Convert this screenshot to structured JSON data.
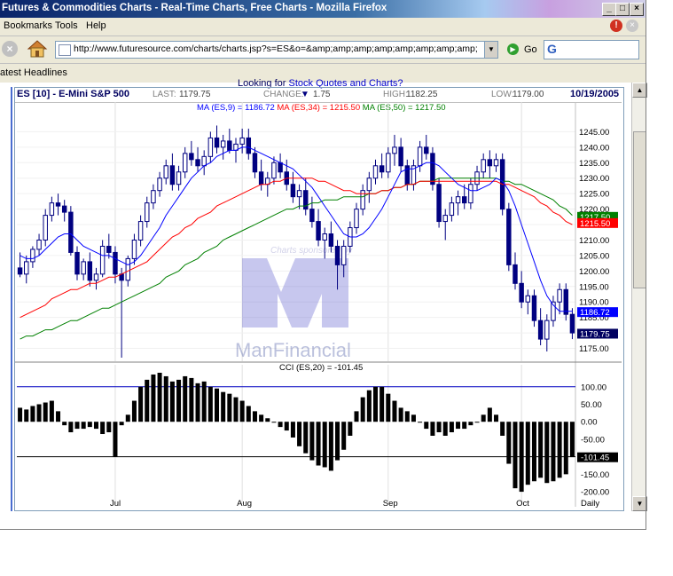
{
  "window": {
    "title": "Futures & Commodities Charts - Real-Time Charts, Free Charts - Mozilla Firefox",
    "min": "_",
    "max": "□",
    "close": "×"
  },
  "menu": {
    "items": [
      "Bookmarks",
      "Tools",
      "Help"
    ]
  },
  "nav": {
    "url": "http://www.futuresource.com/charts/charts.jsp?s=ES&o=&amp;amp;amp;amp;amp;amp;amp;amp;amp;a=D&z=",
    "go_label": "Go",
    "search_value": "G"
  },
  "bookmarks": {
    "headlines": "atest Headlines"
  },
  "page": {
    "prompt_prefix": "Looking for",
    "prompt_link": "Stock Quotes and Charts?"
  },
  "chart_header": {
    "symbol": "ES [10] - E-Mini S&P 500",
    "last_label": "LAST:",
    "last_value": "1179.75",
    "change_label": "CHANGE:",
    "change_arrow": "▼",
    "change_value": "1.75",
    "high_label": "HIGH:",
    "high_value": "1182.25",
    "low_label": "LOW:",
    "low_value": "1179.00",
    "date": "10/19/2005"
  },
  "ma_legend": {
    "ma9": "MA (ES,9) = 1186.72",
    "ma34": "MA (ES,34) = 1215.50",
    "ma50": "MA (ES,50) = 1217.50"
  },
  "watermark": {
    "sponsor": "Charts sponsored by",
    "brand": "ManFinancial"
  },
  "cci_label": "CCI (ES,20) = -101.45",
  "colors": {
    "ma9": "#0000ff",
    "ma34": "#ff0000",
    "ma50": "#008000",
    "header": "#000060"
  },
  "chart_data": {
    "type": "candlestick",
    "price_axis": {
      "ticks": [
        1175,
        1180,
        1185,
        1190,
        1195,
        1200,
        1205,
        1210,
        1215,
        1220,
        1225,
        1230,
        1235,
        1240,
        1245
      ],
      "ylim": [
        1172,
        1250
      ]
    },
    "tick_labels": [
      "1175.00",
      "1180.00",
      "1185.00",
      "1190.00",
      "1195.00",
      "1200.00",
      "1205.00",
      "1210.00",
      "1215.00",
      "1220.00",
      "1225.00",
      "1230.00",
      "1235.00",
      "1240.00",
      "1245.00"
    ],
    "price_tags": [
      {
        "label": "1217.50",
        "value": 1217.5,
        "color": "#008000"
      },
      {
        "label": "1215.50",
        "value": 1215.5,
        "color": "#ff0000"
      },
      {
        "label": "1186.72",
        "value": 1186.72,
        "color": "#0000ff"
      },
      {
        "label": "1179.75",
        "value": 1179.75,
        "color": "#000060"
      }
    ],
    "x_labels": [
      {
        "label": "Jul",
        "index": 15
      },
      {
        "label": "Aug",
        "index": 35
      },
      {
        "label": "Sep",
        "index": 58
      },
      {
        "label": "Oct",
        "index": 79
      },
      {
        "label": "Daily",
        "index": 92
      }
    ],
    "candles": [
      [
        1201,
        1206,
        1198,
        1199
      ],
      [
        1199,
        1205,
        1196,
        1203
      ],
      [
        1203,
        1208,
        1201,
        1207
      ],
      [
        1207,
        1212,
        1205,
        1210
      ],
      [
        1210,
        1220,
        1208,
        1218
      ],
      [
        1218,
        1224,
        1216,
        1222
      ],
      [
        1222,
        1225,
        1218,
        1221
      ],
      [
        1221,
        1223,
        1216,
        1219
      ],
      [
        1219,
        1221,
        1205,
        1206
      ],
      [
        1206,
        1208,
        1197,
        1199
      ],
      [
        1199,
        1204,
        1197,
        1203
      ],
      [
        1203,
        1206,
        1195,
        1197
      ],
      [
        1197,
        1201,
        1194,
        1199
      ],
      [
        1199,
        1210,
        1198,
        1208
      ],
      [
        1208,
        1212,
        1204,
        1206
      ],
      [
        1206,
        1208,
        1196,
        1199
      ],
      [
        1199,
        1201,
        1172,
        1197
      ],
      [
        1197,
        1205,
        1195,
        1204
      ],
      [
        1204,
        1212,
        1202,
        1210
      ],
      [
        1210,
        1218,
        1208,
        1216
      ],
      [
        1216,
        1224,
        1214,
        1222
      ],
      [
        1222,
        1228,
        1220,
        1226
      ],
      [
        1226,
        1232,
        1224,
        1230
      ],
      [
        1230,
        1236,
        1228,
        1234
      ],
      [
        1234,
        1238,
        1226,
        1228
      ],
      [
        1228,
        1234,
        1226,
        1232
      ],
      [
        1232,
        1240,
        1230,
        1238
      ],
      [
        1238,
        1242,
        1234,
        1236
      ],
      [
        1236,
        1240,
        1232,
        1234
      ],
      [
        1234,
        1239,
        1231,
        1237
      ],
      [
        1237,
        1245,
        1235,
        1243
      ],
      [
        1243,
        1247,
        1238,
        1240
      ],
      [
        1240,
        1244,
        1236,
        1242
      ],
      [
        1242,
        1246,
        1238,
        1239
      ],
      [
        1239,
        1243,
        1235,
        1241
      ],
      [
        1241,
        1246,
        1238,
        1243
      ],
      [
        1243,
        1246,
        1236,
        1238
      ],
      [
        1238,
        1240,
        1230,
        1232
      ],
      [
        1232,
        1236,
        1226,
        1228
      ],
      [
        1228,
        1232,
        1224,
        1230
      ],
      [
        1230,
        1237,
        1228,
        1235
      ],
      [
        1235,
        1238,
        1230,
        1232
      ],
      [
        1232,
        1236,
        1226,
        1228
      ],
      [
        1228,
        1232,
        1222,
        1224
      ],
      [
        1224,
        1228,
        1220,
        1226
      ],
      [
        1226,
        1230,
        1218,
        1220
      ],
      [
        1220,
        1224,
        1214,
        1216
      ],
      [
        1216,
        1220,
        1208,
        1210
      ],
      [
        1210,
        1214,
        1204,
        1212
      ],
      [
        1212,
        1216,
        1206,
        1208
      ],
      [
        1208,
        1210,
        1194,
        1202
      ],
      [
        1202,
        1210,
        1198,
        1208
      ],
      [
        1208,
        1216,
        1206,
        1214
      ],
      [
        1214,
        1222,
        1212,
        1220
      ],
      [
        1220,
        1228,
        1218,
        1226
      ],
      [
        1226,
        1232,
        1222,
        1230
      ],
      [
        1230,
        1236,
        1228,
        1234
      ],
      [
        1234,
        1238,
        1230,
        1232
      ],
      [
        1232,
        1240,
        1230,
        1238
      ],
      [
        1238,
        1244,
        1234,
        1240
      ],
      [
        1240,
        1243,
        1232,
        1234
      ],
      [
        1234,
        1236,
        1226,
        1228
      ],
      [
        1228,
        1236,
        1226,
        1234
      ],
      [
        1234,
        1242,
        1232,
        1240
      ],
      [
        1240,
        1244,
        1236,
        1238
      ],
      [
        1238,
        1240,
        1226,
        1228
      ],
      [
        1228,
        1230,
        1214,
        1216
      ],
      [
        1216,
        1220,
        1210,
        1218
      ],
      [
        1218,
        1224,
        1216,
        1222
      ],
      [
        1222,
        1226,
        1218,
        1224
      ],
      [
        1224,
        1228,
        1220,
        1222
      ],
      [
        1222,
        1230,
        1220,
        1228
      ],
      [
        1228,
        1234,
        1226,
        1232
      ],
      [
        1232,
        1238,
        1230,
        1236
      ],
      [
        1236,
        1239,
        1230,
        1234
      ],
      [
        1234,
        1238,
        1232,
        1236
      ],
      [
        1236,
        1238,
        1218,
        1220
      ],
      [
        1220,
        1222,
        1200,
        1202
      ],
      [
        1202,
        1206,
        1194,
        1196
      ],
      [
        1196,
        1200,
        1188,
        1190
      ],
      [
        1190,
        1194,
        1186,
        1192
      ],
      [
        1192,
        1194,
        1182,
        1184
      ],
      [
        1184,
        1188,
        1176,
        1178
      ],
      [
        1178,
        1186,
        1174,
        1184
      ],
      [
        1184,
        1192,
        1182,
        1190
      ],
      [
        1190,
        1196,
        1186,
        1194
      ],
      [
        1194,
        1196,
        1184,
        1186
      ],
      [
        1186,
        1188,
        1178,
        1180
      ]
    ],
    "ma9": [
      1205,
      1204,
      1204,
      1205,
      1207,
      1209,
      1211,
      1212,
      1212,
      1210,
      1208,
      1207,
      1206,
      1205,
      1205,
      1204,
      1203,
      1202,
      1203,
      1205,
      1208,
      1211,
      1214,
      1218,
      1221,
      1224,
      1227,
      1230,
      1232,
      1234,
      1235,
      1237,
      1238,
      1239,
      1239,
      1240,
      1240,
      1239,
      1238,
      1237,
      1236,
      1235,
      1234,
      1233,
      1231,
      1229,
      1227,
      1224,
      1221,
      1218,
      1215,
      1212,
      1211,
      1211,
      1212,
      1214,
      1217,
      1220,
      1224,
      1228,
      1232,
      1233,
      1233,
      1234,
      1235,
      1235,
      1234,
      1232,
      1230,
      1228,
      1227,
      1226,
      1226,
      1227,
      1228,
      1230,
      1229,
      1226,
      1221,
      1215,
      1209,
      1203,
      1197,
      1192,
      1189,
      1187,
      1187,
      1187
    ],
    "ma34": [
      1185,
      1186,
      1187,
      1188,
      1189,
      1191,
      1192,
      1193,
      1194,
      1194,
      1195,
      1196,
      1196,
      1197,
      1198,
      1198,
      1199,
      1200,
      1201,
      1202,
      1203,
      1205,
      1207,
      1209,
      1211,
      1212,
      1214,
      1215,
      1217,
      1218,
      1219,
      1221,
      1222,
      1223,
      1224,
      1225,
      1226,
      1227,
      1228,
      1228,
      1229,
      1229,
      1230,
      1230,
      1230,
      1230,
      1230,
      1229,
      1229,
      1228,
      1227,
      1226,
      1226,
      1225,
      1225,
      1225,
      1225,
      1226,
      1226,
      1227,
      1227,
      1228,
      1228,
      1229,
      1229,
      1229,
      1229,
      1229,
      1229,
      1229,
      1229,
      1229,
      1229,
      1229,
      1229,
      1229,
      1228,
      1228,
      1227,
      1226,
      1225,
      1224,
      1222,
      1221,
      1219,
      1218,
      1216,
      1215
    ],
    "ma50": [
      1178,
      1179,
      1179,
      1180,
      1181,
      1181,
      1182,
      1183,
      1184,
      1184,
      1185,
      1186,
      1187,
      1188,
      1188,
      1189,
      1190,
      1191,
      1192,
      1193,
      1194,
      1195,
      1196,
      1198,
      1199,
      1200,
      1202,
      1203,
      1204,
      1206,
      1207,
      1208,
      1210,
      1211,
      1212,
      1213,
      1214,
      1215,
      1216,
      1217,
      1218,
      1219,
      1220,
      1220,
      1221,
      1221,
      1222,
      1222,
      1223,
      1223,
      1223,
      1224,
      1224,
      1224,
      1224,
      1225,
      1225,
      1226,
      1226,
      1227,
      1227,
      1228,
      1228,
      1229,
      1229,
      1229,
      1230,
      1230,
      1230,
      1230,
      1230,
      1230,
      1230,
      1230,
      1230,
      1230,
      1229,
      1229,
      1228,
      1228,
      1227,
      1226,
      1225,
      1224,
      1223,
      1221,
      1220,
      1218
    ],
    "cci_axis": {
      "ticks": [
        100,
        50,
        0,
        -50,
        -100,
        -150,
        -200
      ],
      "ylim": [
        -215,
        140
      ]
    },
    "cci_tick_labels": [
      "100.00",
      "50.00",
      "0.00",
      "-50.00",
      "-100.00",
      "-150.00",
      "-200.00"
    ],
    "cci_tag": {
      "label": "-101.45",
      "value": -101.45
    },
    "cci": [
      40,
      35,
      45,
      50,
      55,
      60,
      30,
      -10,
      -30,
      -20,
      -20,
      -15,
      -20,
      -35,
      -30,
      -100,
      -10,
      20,
      60,
      100,
      120,
      135,
      140,
      130,
      115,
      120,
      130,
      125,
      110,
      115,
      100,
      95,
      85,
      80,
      70,
      60,
      45,
      30,
      20,
      10,
      0,
      -15,
      -25,
      -45,
      -70,
      -90,
      -110,
      -125,
      -130,
      -140,
      -110,
      -80,
      -40,
      30,
      70,
      90,
      100,
      100,
      80,
      60,
      40,
      30,
      20,
      0,
      -20,
      -40,
      -30,
      -40,
      -30,
      -20,
      -20,
      -10,
      0,
      20,
      40,
      20,
      -40,
      -120,
      -190,
      -200,
      -180,
      -170,
      -160,
      -175,
      -170,
      -160,
      -150,
      -101
    ]
  }
}
